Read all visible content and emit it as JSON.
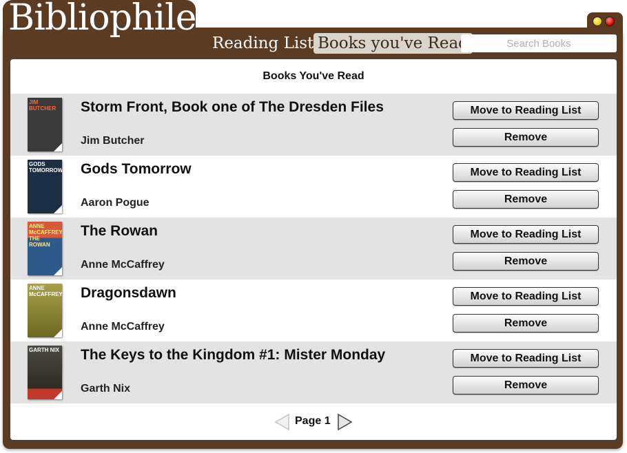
{
  "app": {
    "title": "Bibliophile"
  },
  "nav": {
    "tabs": [
      {
        "label": "Reading List"
      },
      {
        "label": "Books you've Read",
        "active": true
      }
    ]
  },
  "search": {
    "placeholder": "Search Books"
  },
  "main": {
    "title": "Books You've Read",
    "books": [
      {
        "title": "Storm Front, Book one of The Dresden Files",
        "author": "Jim Butcher",
        "cover_text": "JIM BUTCHER",
        "cover_color": "#3a3a3a"
      },
      {
        "title": "Gods Tomorrow",
        "author": "Aaron Pogue",
        "cover_text": "GODS TOMORROW",
        "cover_color": "#1c2e44"
      },
      {
        "title": "The Rowan",
        "author": "Anne McCaffrey",
        "cover_text": "ANNE McCAFFREY THE ROWAN",
        "cover_color": "#2d5a8a"
      },
      {
        "title": "Dragonsdawn",
        "author": "Anne McCaffrey",
        "cover_text": "ANNE McCAFFREY",
        "cover_color": "#7a7a22"
      },
      {
        "title": "The Keys to the Kingdom #1: Mister Monday",
        "author": "Garth Nix",
        "cover_text": "GARTH NIX",
        "cover_color": "#3d3a33"
      }
    ],
    "move_label": "Move to Reading List",
    "remove_label": "Remove"
  },
  "pager": {
    "label": "Page 1"
  },
  "colors": {
    "frame": "#5b3b22",
    "row_alt": "#e3e3e3"
  },
  "icons": {
    "prev": "triangle-left-icon",
    "next": "triangle-right-icon"
  }
}
